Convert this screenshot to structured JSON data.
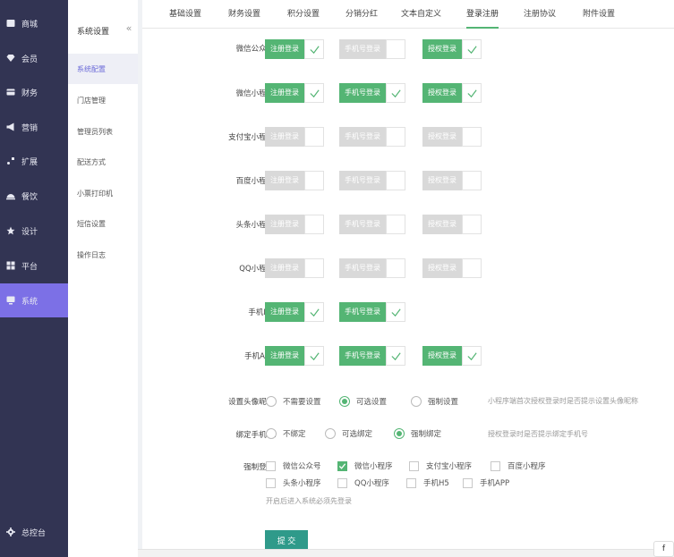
{
  "sidebar": {
    "items": [
      {
        "label": "商城",
        "icon": "store-icon"
      },
      {
        "label": "会员",
        "icon": "member-icon"
      },
      {
        "label": "财务",
        "icon": "finance-icon"
      },
      {
        "label": "营销",
        "icon": "marketing-icon"
      },
      {
        "label": "扩展",
        "icon": "extension-icon"
      },
      {
        "label": "餐饮",
        "icon": "catering-icon"
      },
      {
        "label": "设计",
        "icon": "design-icon"
      },
      {
        "label": "平台",
        "icon": "platform-icon"
      },
      {
        "label": "系统",
        "icon": "system-icon",
        "active": true
      }
    ],
    "footer": {
      "label": "总控台",
      "icon": "gear-icon"
    }
  },
  "submenu": {
    "title": "系统设置",
    "collapse": "«",
    "items": [
      "系统配置",
      "门店管理",
      "管理员列表",
      "配送方式",
      "小票打印机",
      "短信设置",
      "操作日志"
    ]
  },
  "tabs": [
    "基础设置",
    "财务设置",
    "积分设置",
    "分销分红",
    "文本自定义",
    "登录注册",
    "注册协议",
    "附件设置"
  ],
  "form": {
    "rows": [
      {
        "label": "微信公众号:",
        "toggles": [
          {
            "text": "注册登录",
            "on": true
          },
          {
            "text": "手机号登录",
            "on": false
          },
          {
            "text": "授权登录",
            "on": true
          }
        ]
      },
      {
        "label": "微信小程序:",
        "toggles": [
          {
            "text": "注册登录",
            "on": true
          },
          {
            "text": "手机号登录",
            "on": true
          },
          {
            "text": "授权登录",
            "on": true
          }
        ]
      },
      {
        "label": "支付宝小程序:",
        "toggles": [
          {
            "text": "注册登录",
            "on": false
          },
          {
            "text": "手机号登录",
            "on": false
          },
          {
            "text": "授权登录",
            "on": false
          }
        ]
      },
      {
        "label": "百度小程序:",
        "toggles": [
          {
            "text": "注册登录",
            "on": false
          },
          {
            "text": "手机号登录",
            "on": false
          },
          {
            "text": "授权登录",
            "on": false
          }
        ]
      },
      {
        "label": "头条小程序:",
        "toggles": [
          {
            "text": "注册登录",
            "on": false
          },
          {
            "text": "手机号登录",
            "on": false
          },
          {
            "text": "授权登录",
            "on": false
          }
        ]
      },
      {
        "label": "QQ小程序:",
        "toggles": [
          {
            "text": "注册登录",
            "on": false
          },
          {
            "text": "手机号登录",
            "on": false
          },
          {
            "text": "授权登录",
            "on": false
          }
        ]
      },
      {
        "label": "手机H5:",
        "toggles": [
          {
            "text": "注册登录",
            "on": true
          },
          {
            "text": "手机号登录",
            "on": true
          }
        ]
      },
      {
        "label": "手机APP:",
        "toggles": [
          {
            "text": "注册登录",
            "on": true
          },
          {
            "text": "手机号登录",
            "on": true
          },
          {
            "text": "授权登录",
            "on": true
          }
        ]
      }
    ],
    "avatar": {
      "label": "设置头像昵称:",
      "options": [
        "不需要设置",
        "可选设置",
        "强制设置"
      ],
      "selected": 1,
      "hint": "小程序端首次授权登录时是否提示设置头像昵称"
    },
    "bind_phone": {
      "label": "绑定手机号:",
      "options": [
        "不绑定",
        "可选绑定",
        "强制绑定"
      ],
      "selected": 2,
      "hint": "授权登录时是否提示绑定手机号"
    },
    "force_login": {
      "label": "强制登录:",
      "options": [
        {
          "text": "微信公众号",
          "checked": false
        },
        {
          "text": "微信小程序",
          "checked": true
        },
        {
          "text": "支付宝小程序",
          "checked": false
        },
        {
          "text": "百度小程序",
          "checked": false
        },
        {
          "text": "头条小程序",
          "checked": false
        },
        {
          "text": "QQ小程序",
          "checked": false
        },
        {
          "text": "手机H5",
          "checked": false
        },
        {
          "text": "手机APP",
          "checked": false
        }
      ],
      "note": "开启后进入系统必须先登录"
    },
    "submit": "提 交"
  },
  "corner_badge": "f",
  "colors": {
    "accent": "#54b574",
    "sidebar": "#323453",
    "sidebar_active": "#7c70e6",
    "submit": "#2f9a8a"
  }
}
